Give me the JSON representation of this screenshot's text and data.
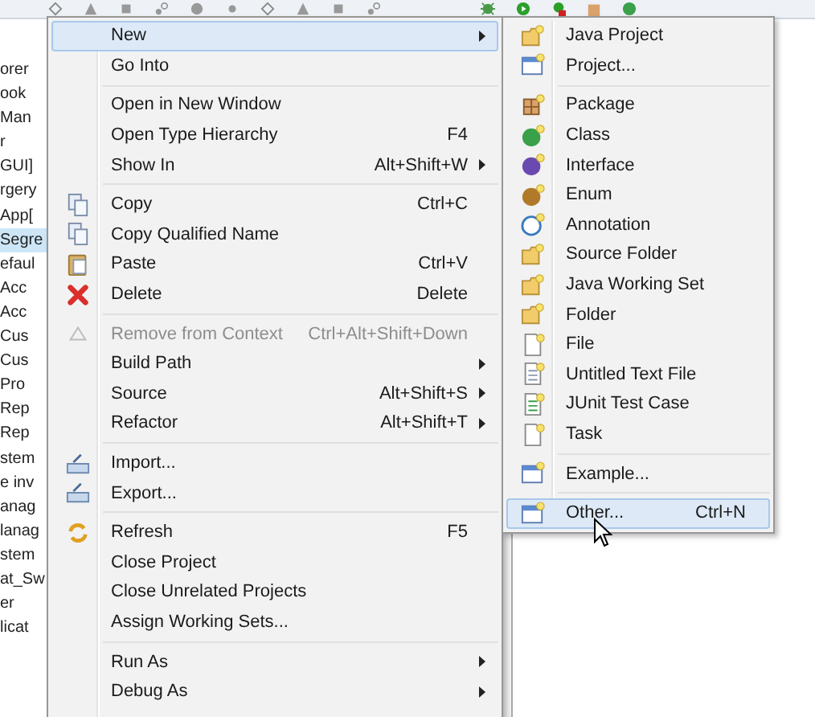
{
  "tree": {
    "items": [
      {
        "label": "orer",
        "selected": false
      },
      {
        "label": "ook",
        "selected": false
      },
      {
        "label": "Man",
        "selected": false
      },
      {
        "label": "r",
        "selected": false
      },
      {
        "label": "GUI]",
        "selected": false
      },
      {
        "label": "rgery",
        "selected": false
      },
      {
        "label": "App[",
        "selected": false
      },
      {
        "label": "Segre",
        "selected": true
      },
      {
        "label": "efaul",
        "selected": false
      },
      {
        "label": "Acc",
        "selected": false
      },
      {
        "label": "Acc",
        "selected": false
      },
      {
        "label": "Cus",
        "selected": false
      },
      {
        "label": "Cus",
        "selected": false
      },
      {
        "label": "Pro",
        "selected": false
      },
      {
        "label": "Rep",
        "selected": false
      },
      {
        "label": "Rep",
        "selected": false
      },
      {
        "label": "stem",
        "selected": false
      },
      {
        "label": "e inv",
        "selected": false
      },
      {
        "label": "anag",
        "selected": false
      },
      {
        "label": "lanag",
        "selected": false
      },
      {
        "label": "stem",
        "selected": false
      },
      {
        "label": "at_Sw",
        "selected": false
      },
      {
        "label": "er",
        "selected": false
      },
      {
        "label": "licat",
        "selected": false
      }
    ]
  },
  "context_menu": {
    "groups": [
      [
        {
          "label": "New",
          "has_submenu": true,
          "disabled": false,
          "selected": true
        },
        {
          "label": "Go Into",
          "has_submenu": false,
          "disabled": false,
          "selected": false
        }
      ],
      [
        {
          "label": "Open in New Window",
          "has_submenu": false,
          "disabled": false,
          "selected": false
        },
        {
          "label": "Open Type Hierarchy",
          "shortcut": "F4",
          "has_submenu": false,
          "disabled": false,
          "selected": false
        },
        {
          "label": "Show In",
          "shortcut": "Alt+Shift+W",
          "has_submenu": true,
          "disabled": false,
          "selected": false
        }
      ],
      [
        {
          "label": "Copy",
          "shortcut": "Ctrl+C",
          "has_submenu": false,
          "disabled": false,
          "selected": false
        },
        {
          "label": "Copy Qualified Name",
          "has_submenu": false,
          "disabled": false,
          "selected": false
        },
        {
          "label": "Paste",
          "shortcut": "Ctrl+V",
          "has_submenu": false,
          "disabled": false,
          "selected": false
        },
        {
          "label": "Delete",
          "shortcut": "Delete",
          "has_submenu": false,
          "disabled": false,
          "selected": false
        }
      ],
      [
        {
          "label": "Remove from Context",
          "shortcut": "Ctrl+Alt+Shift+Down",
          "has_submenu": false,
          "disabled": true,
          "selected": false
        },
        {
          "label": "Build Path",
          "has_submenu": true,
          "disabled": false,
          "selected": false
        },
        {
          "label": "Source",
          "shortcut": "Alt+Shift+S",
          "has_submenu": true,
          "disabled": false,
          "selected": false
        },
        {
          "label": "Refactor",
          "shortcut": "Alt+Shift+T",
          "has_submenu": true,
          "disabled": false,
          "selected": false
        }
      ],
      [
        {
          "label": "Import...",
          "has_submenu": false,
          "disabled": false,
          "selected": false
        },
        {
          "label": "Export...",
          "has_submenu": false,
          "disabled": false,
          "selected": false
        }
      ],
      [
        {
          "label": "Refresh",
          "shortcut": "F5",
          "has_submenu": false,
          "disabled": false,
          "selected": false
        },
        {
          "label": "Close Project",
          "has_submenu": false,
          "disabled": false,
          "selected": false
        },
        {
          "label": "Close Unrelated Projects",
          "has_submenu": false,
          "disabled": false,
          "selected": false
        },
        {
          "label": "Assign Working Sets...",
          "has_submenu": false,
          "disabled": false,
          "selected": false
        }
      ],
      [
        {
          "label": "Run As",
          "has_submenu": true,
          "disabled": false,
          "selected": false
        },
        {
          "label": "Debug As",
          "has_submenu": true,
          "disabled": false,
          "selected": false
        }
      ]
    ]
  },
  "new_submenu": {
    "groups": [
      [
        {
          "label": "Java Project",
          "selected": false
        },
        {
          "label": "Project...",
          "selected": false
        }
      ],
      [
        {
          "label": "Package",
          "selected": false
        },
        {
          "label": "Class",
          "selected": false
        },
        {
          "label": "Interface",
          "selected": false
        },
        {
          "label": "Enum",
          "selected": false
        },
        {
          "label": "Annotation",
          "selected": false
        },
        {
          "label": "Source Folder",
          "selected": false
        },
        {
          "label": "Java Working Set",
          "selected": false
        },
        {
          "label": "Folder",
          "selected": false
        },
        {
          "label": "File",
          "selected": false
        },
        {
          "label": "Untitled Text File",
          "selected": false
        },
        {
          "label": "JUnit Test Case",
          "selected": false
        },
        {
          "label": "Task",
          "selected": false
        }
      ],
      [
        {
          "label": "Example...",
          "selected": false
        }
      ],
      [
        {
          "label": "Other...",
          "shortcut": "Ctrl+N",
          "selected": true
        }
      ]
    ]
  }
}
